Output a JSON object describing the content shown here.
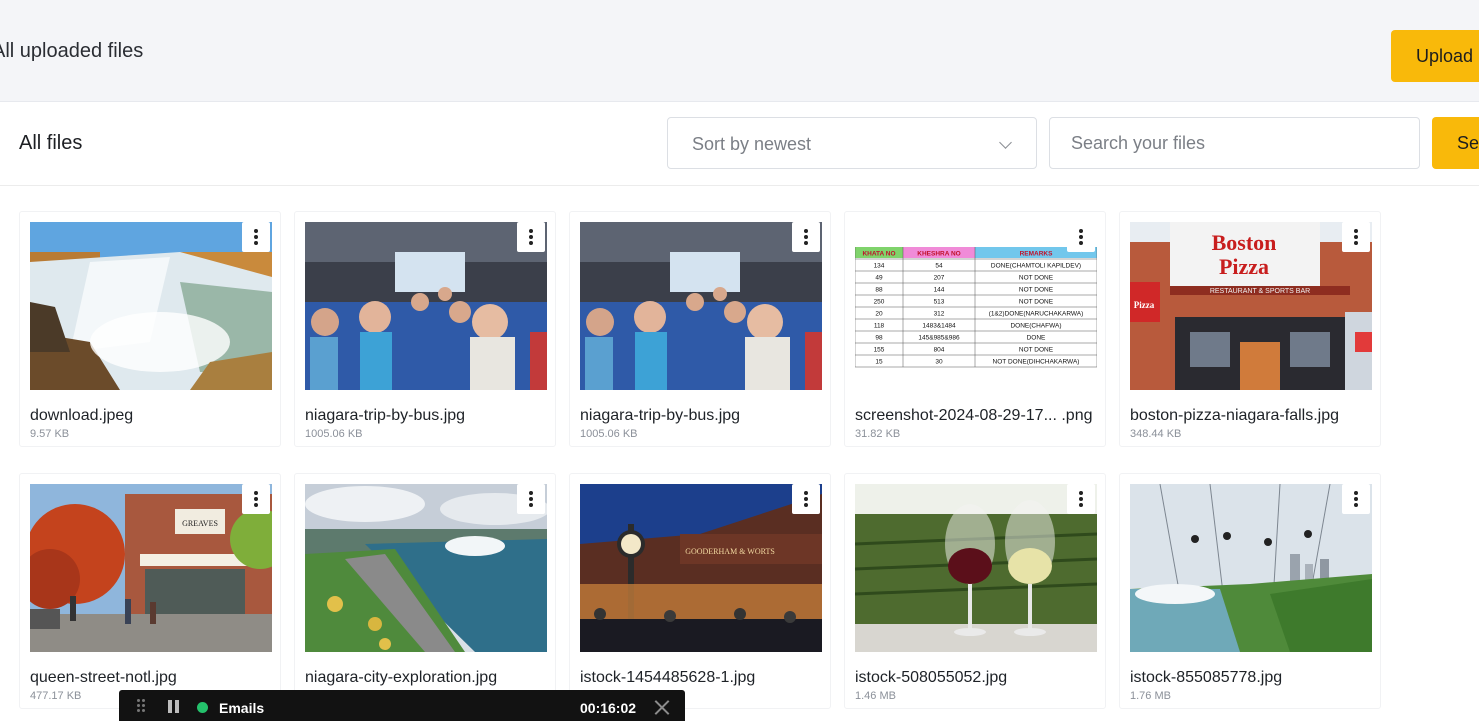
{
  "header": {
    "title": "All uploaded files",
    "upload_button": "Upload File"
  },
  "toolbar": {
    "heading": "All files",
    "sort": {
      "selected": "Sort by newest"
    },
    "search": {
      "placeholder": "Search your files",
      "button": "Search"
    }
  },
  "files": [
    {
      "name": "download.jpeg",
      "size": "9.57 KB",
      "thumb": "waterfall"
    },
    {
      "name": "niagara-trip-by-bus.jpg",
      "size": "1005.06 KB",
      "thumb": "bus"
    },
    {
      "name": "niagara-trip-by-bus.jpg",
      "size": "1005.06 KB",
      "thumb": "bus"
    },
    {
      "name": "screenshot-2024-08-29-17... .png",
      "size": "31.82 KB",
      "thumb": "table"
    },
    {
      "name": "boston-pizza-niagara-falls.jpg",
      "size": "348.44 KB",
      "thumb": "pizza"
    },
    {
      "name": "queen-street-notl.jpg",
      "size": "477.17 KB",
      "thumb": "street"
    },
    {
      "name": "niagara-city-exploration.jpg",
      "size": "",
      "thumb": "river"
    },
    {
      "name": "istock-1454485628-1.jpg",
      "size": "",
      "thumb": "night"
    },
    {
      "name": "istock-508055052.jpg",
      "size": "1.46 MB",
      "thumb": "wine"
    },
    {
      "name": "istock-855085778.jpg",
      "size": "1.76 MB",
      "thumb": "zipline"
    }
  ],
  "thumb_text": {
    "table": {
      "headers": [
        "KHATA NO",
        "KHESHRA NO",
        "REMARKS"
      ],
      "rows": [
        [
          "134",
          "54",
          "DONE(CHAMTOLI KAPILDEV)"
        ],
        [
          "49",
          "207",
          "NOT DONE"
        ],
        [
          "88",
          "144",
          "NOT DONE"
        ],
        [
          "250",
          "513",
          "NOT DONE"
        ],
        [
          "20",
          "312",
          "(1&2)DONE(NARUCHAKARWA)"
        ],
        [
          "118",
          "1483&1484",
          "DONE(CHAFWA)"
        ],
        [
          "98",
          "145&985&986",
          "DONE"
        ],
        [
          "155",
          "804",
          "NOT DONE"
        ],
        [
          "15",
          "30",
          "NOT DONE(DIHCHAKARWA)"
        ]
      ]
    },
    "pizza": {
      "brand_line1": "Boston",
      "brand_line2": "Pizza",
      "tagline": "RESTAURANT & SPORTS BAR",
      "side": "Pizza"
    },
    "street": {
      "sign": "GREAVES"
    },
    "night": {
      "sign": "GOODERHAM & WORTS"
    }
  },
  "recorder": {
    "label": "Emails",
    "timer": "00:16:02",
    "status_color": "#24c16b"
  },
  "colors": {
    "accent": "#f9b90a",
    "header_bg": "#f4f5f8"
  }
}
